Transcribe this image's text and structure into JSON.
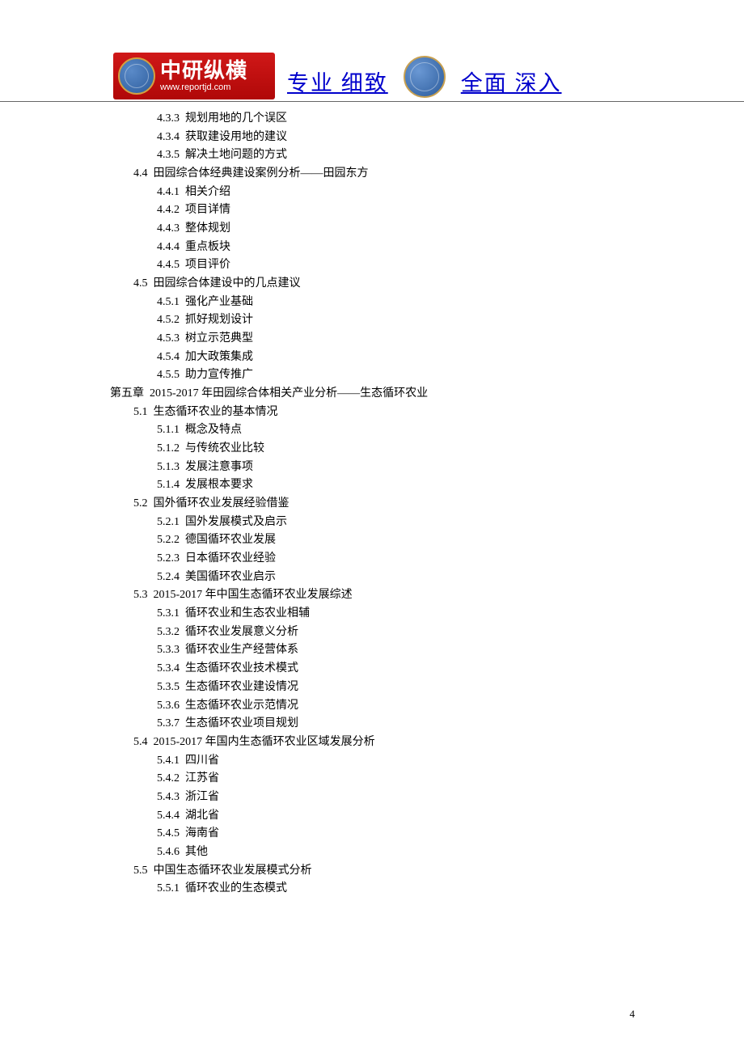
{
  "header": {
    "logo_cn": "中研纵横",
    "logo_url": "www.reportjd.com",
    "link_left": "专业  细致",
    "link_right": "全面  深入"
  },
  "toc": [
    {
      "level": "sub",
      "num": "4.3.3",
      "title": "规划用地的几个误区"
    },
    {
      "level": "sub",
      "num": "4.3.4",
      "title": "获取建设用地的建议"
    },
    {
      "level": "sub",
      "num": "4.3.5",
      "title": "解决土地问题的方式"
    },
    {
      "level": "section",
      "num": "4.4",
      "title": "田园综合体经典建设案例分析——田园东方"
    },
    {
      "level": "sub",
      "num": "4.4.1",
      "title": "相关介绍"
    },
    {
      "level": "sub",
      "num": "4.4.2",
      "title": "项目详情"
    },
    {
      "level": "sub",
      "num": "4.4.3",
      "title": "整体规划"
    },
    {
      "level": "sub",
      "num": "4.4.4",
      "title": "重点板块"
    },
    {
      "level": "sub",
      "num": "4.4.5",
      "title": "项目评价"
    },
    {
      "level": "section",
      "num": "4.5",
      "title": "田园综合体建设中的几点建议"
    },
    {
      "level": "sub",
      "num": "4.5.1",
      "title": "强化产业基础"
    },
    {
      "level": "sub",
      "num": "4.5.2",
      "title": "抓好规划设计"
    },
    {
      "level": "sub",
      "num": "4.5.3",
      "title": "树立示范典型"
    },
    {
      "level": "sub",
      "num": "4.5.4",
      "title": "加大政策集成"
    },
    {
      "level": "sub",
      "num": "4.5.5",
      "title": "助力宣传推广"
    },
    {
      "level": "chapter",
      "num": "第五章",
      "title": "2015-2017 年田园综合体相关产业分析——生态循环农业"
    },
    {
      "level": "section",
      "num": "5.1",
      "title": "生态循环农业的基本情况"
    },
    {
      "level": "sub",
      "num": "5.1.1",
      "title": "概念及特点"
    },
    {
      "level": "sub",
      "num": "5.1.2",
      "title": "与传统农业比较"
    },
    {
      "level": "sub",
      "num": "5.1.3",
      "title": "发展注意事项"
    },
    {
      "level": "sub",
      "num": "5.1.4",
      "title": "发展根本要求"
    },
    {
      "level": "section",
      "num": "5.2",
      "title": "国外循环农业发展经验借鉴"
    },
    {
      "level": "sub",
      "num": "5.2.1",
      "title": "国外发展模式及启示"
    },
    {
      "level": "sub",
      "num": "5.2.2",
      "title": "德国循环农业发展"
    },
    {
      "level": "sub",
      "num": "5.2.3",
      "title": "日本循环农业经验"
    },
    {
      "level": "sub",
      "num": "5.2.4",
      "title": "美国循环农业启示"
    },
    {
      "level": "section",
      "num": "5.3",
      "title": "2015-2017 年中国生态循环农业发展综述"
    },
    {
      "level": "sub",
      "num": "5.3.1",
      "title": "循环农业和生态农业相辅"
    },
    {
      "level": "sub",
      "num": "5.3.2",
      "title": "循环农业发展意义分析"
    },
    {
      "level": "sub",
      "num": "5.3.3",
      "title": "循环农业生产经营体系"
    },
    {
      "level": "sub",
      "num": "5.3.4",
      "title": "生态循环农业技术模式"
    },
    {
      "level": "sub",
      "num": "5.3.5",
      "title": "生态循环农业建设情况"
    },
    {
      "level": "sub",
      "num": "5.3.6",
      "title": "生态循环农业示范情况"
    },
    {
      "level": "sub",
      "num": "5.3.7",
      "title": "生态循环农业项目规划"
    },
    {
      "level": "section",
      "num": "5.4",
      "title": "2015-2017 年国内生态循环农业区域发展分析"
    },
    {
      "level": "sub",
      "num": "5.4.1",
      "title": "四川省"
    },
    {
      "level": "sub",
      "num": "5.4.2",
      "title": "江苏省"
    },
    {
      "level": "sub",
      "num": "5.4.3",
      "title": "浙江省"
    },
    {
      "level": "sub",
      "num": "5.4.4",
      "title": "湖北省"
    },
    {
      "level": "sub",
      "num": "5.4.5",
      "title": "海南省"
    },
    {
      "level": "sub",
      "num": "5.4.6",
      "title": "其他"
    },
    {
      "level": "section",
      "num": "5.5",
      "title": "中国生态循环农业发展模式分析"
    },
    {
      "level": "sub",
      "num": "5.5.1",
      "title": "循环农业的生态模式"
    }
  ],
  "page_number": "4"
}
